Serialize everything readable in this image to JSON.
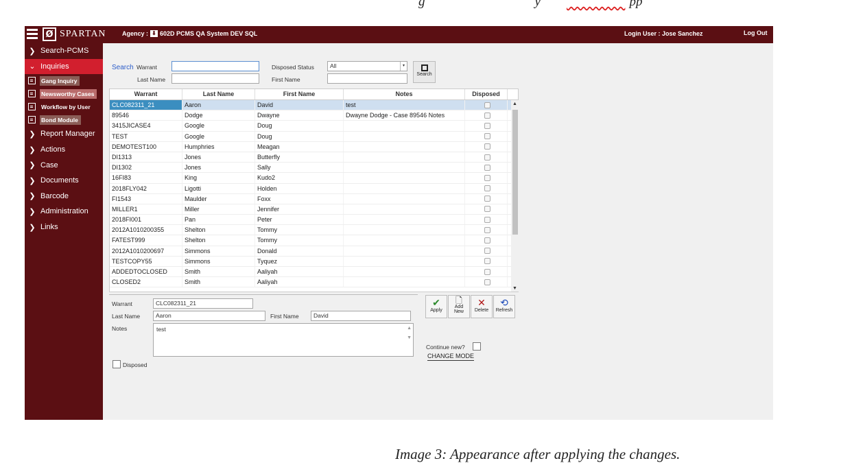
{
  "doc": {
    "top_fragment_a": "g",
    "top_fragment_b": "y",
    "top_fragment_c": "pp",
    "caption": "Image 3: Appearance after applying the changes."
  },
  "header": {
    "brand": "SPARTAN",
    "agency_label": "Agency :",
    "agency_value": "602D PCMS QA System DEV SQL",
    "login": "Login User : Jose Sanchez",
    "logout": "Log Out"
  },
  "sidebar": {
    "items": [
      {
        "label": "Search-PCMS"
      },
      {
        "label": "Inquiries"
      },
      {
        "label": "Report Manager"
      },
      {
        "label": "Actions"
      },
      {
        "label": "Case"
      },
      {
        "label": "Documents"
      },
      {
        "label": "Barcode"
      },
      {
        "label": "Administration"
      },
      {
        "label": "Links"
      }
    ],
    "subitems": [
      {
        "label": "Gang Inquiry"
      },
      {
        "label": "Newsworthy Cases"
      },
      {
        "label": "Workflow by User"
      },
      {
        "label": "Bond Module"
      }
    ]
  },
  "search": {
    "tag": "Search",
    "warrant_label": "Warrant",
    "warrant_value": "",
    "lastname_label": "Last Name",
    "lastname_value": "",
    "disposed_status_label": "Disposed Status",
    "disposed_status_value": "All",
    "firstname_label": "First Name",
    "firstname_value": "",
    "button_label": "Search"
  },
  "table": {
    "columns": [
      "Warrant",
      "Last Name",
      "First Name",
      "Notes",
      "Disposed"
    ],
    "rows": [
      {
        "warrant": "CLC082311_21",
        "last": "Aaron",
        "first": "David",
        "notes": "test"
      },
      {
        "warrant": "89546",
        "last": "Dodge",
        "first": "Dwayne",
        "notes": "Dwayne Dodge - Case 89546 Notes"
      },
      {
        "warrant": "3415JICASE4",
        "last": "Google",
        "first": "Doug",
        "notes": ""
      },
      {
        "warrant": "TEST",
        "last": "Google",
        "first": "Doug",
        "notes": ""
      },
      {
        "warrant": "DEMOTEST100",
        "last": "Humphries",
        "first": "Meagan",
        "notes": ""
      },
      {
        "warrant": "DI1313",
        "last": "Jones",
        "first": "Butterfly",
        "notes": ""
      },
      {
        "warrant": "DI1302",
        "last": "Jones",
        "first": "Sally",
        "notes": ""
      },
      {
        "warrant": "16FI83",
        "last": "King",
        "first": "Kudo2",
        "notes": ""
      },
      {
        "warrant": "2018FLY042",
        "last": "Ligotti",
        "first": "Holden",
        "notes": ""
      },
      {
        "warrant": "FI1543",
        "last": "Maulder",
        "first": "Foxx",
        "notes": ""
      },
      {
        "warrant": "MILLER1",
        "last": "Miller",
        "first": "Jennifer",
        "notes": ""
      },
      {
        "warrant": "2018FI001",
        "last": "Pan",
        "first": "Peter",
        "notes": ""
      },
      {
        "warrant": "2012A1010200355",
        "last": "Shelton",
        "first": "Tommy",
        "notes": ""
      },
      {
        "warrant": "FATEST999",
        "last": "Shelton",
        "first": "Tommy",
        "notes": ""
      },
      {
        "warrant": "2012A1010200697",
        "last": "Simmons",
        "first": "Donald",
        "notes": ""
      },
      {
        "warrant": "TESTCOPY55",
        "last": "Simmons",
        "first": "Tyquez",
        "notes": ""
      },
      {
        "warrant": "ADDEDTOCLOSED",
        "last": "Smith",
        "first": "Aaliyah",
        "notes": ""
      },
      {
        "warrant": "CLOSED2",
        "last": "Smith",
        "first": "Aaliyah",
        "notes": ""
      }
    ]
  },
  "detail": {
    "warrant_label": "Warrant",
    "warrant_value": "CLC082311_21",
    "lastname_label": "Last Name",
    "lastname_value": "Aaron",
    "firstname_label": "First Name",
    "firstname_value": "David",
    "notes_label": "Notes",
    "notes_value": "test",
    "disposed_label": "Disposed",
    "continue_label": "Continue new?",
    "change_mode": "CHANGE MODE"
  },
  "actions": {
    "apply": "Apply",
    "add_new_1": "Add",
    "add_new_2": "New",
    "delete": "Delete",
    "refresh": "Refresh"
  },
  "colors": {
    "brand": "#5b0f13",
    "active_nav": "#d21f2e",
    "selected_cell": "#3b8ec0",
    "search_tag": "#2b5cc8"
  }
}
